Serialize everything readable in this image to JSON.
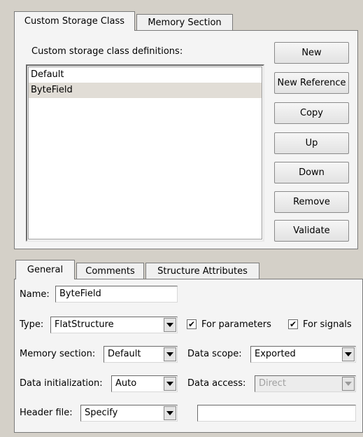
{
  "top_tabs": [
    {
      "label": "Custom Storage Class",
      "active": true
    },
    {
      "label": "Memory Section",
      "active": false
    }
  ],
  "definitions": {
    "label": "Custom storage class definitions:",
    "items": [
      "Default",
      "ByteField"
    ],
    "selected": "ByteField"
  },
  "buttons": {
    "new": "New",
    "new_reference": "New Reference",
    "copy": "Copy",
    "up": "Up",
    "down": "Down",
    "remove": "Remove",
    "validate": "Validate"
  },
  "bottom_tabs": [
    {
      "label": "General",
      "active": true
    },
    {
      "label": "Comments",
      "active": false
    },
    {
      "label": "Structure Attributes",
      "active": false
    }
  ],
  "general": {
    "name_label": "Name:",
    "name_value": "ByteField",
    "type_label": "Type:",
    "type_value": "FlatStructure",
    "for_parameters_label": "For parameters",
    "for_parameters_checked": true,
    "for_signals_label": "For signals",
    "for_signals_checked": true,
    "memory_section_label": "Memory section:",
    "memory_section_value": "Default",
    "data_scope_label": "Data scope:",
    "data_scope_value": "Exported",
    "data_init_label": "Data initialization:",
    "data_init_value": "Auto",
    "data_access_label": "Data access:",
    "data_access_value": "Direct",
    "header_file_label": "Header file:",
    "header_file_value": "Specify",
    "header_file_name": ""
  },
  "check_mark": "✔",
  "colors": {
    "window_bg": "#d4d0c8",
    "panel_bg": "#f4f4f4",
    "selection_bg": "#e1ddd6"
  }
}
